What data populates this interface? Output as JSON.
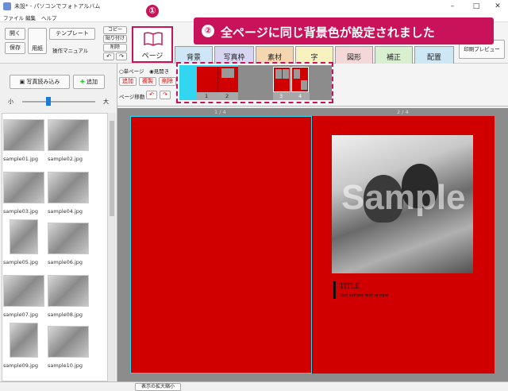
{
  "window": {
    "title": "未設* - パソコンでフォトアルバム",
    "controls": [
      "–",
      "□",
      "✕"
    ]
  },
  "menu": [
    "ファイル",
    "編集",
    "ヘルプ"
  ],
  "toolbar": {
    "open": "開く",
    "save": "保存",
    "paper": "用紙",
    "template": "テンプレート",
    "manual": "操作マニュアル",
    "copy": "コピー",
    "paste": "貼り付け",
    "delete": "削除",
    "print_preview": "印刷プレビュー"
  },
  "tabs": [
    {
      "label": "ページ",
      "color": "#ffffff"
    },
    {
      "label": "背景",
      "color": "#cfe6f7"
    },
    {
      "label": "写真枠",
      "color": "#d6d6f2"
    },
    {
      "label": "素材",
      "color": "#f4d7b0"
    },
    {
      "label": "字",
      "color": "#f7f2c0"
    },
    {
      "label": "図形",
      "color": "#f4d7d7"
    },
    {
      "label": "補正",
      "color": "#d8f0d0"
    },
    {
      "label": "配置",
      "color": "#cde8f4"
    }
  ],
  "page_panel": {
    "single": "単ページ",
    "spread": "見開き",
    "add": "追加",
    "duplicate": "複製",
    "delete": "削除",
    "move": "ページ移動",
    "pages": [
      "1",
      "2",
      "3",
      "4"
    ]
  },
  "callouts": {
    "step1": "①",
    "step2": "②",
    "message": "全ページに同じ背景色が設定されました"
  },
  "left": {
    "load_photos": "写真読み込み",
    "add": "追加",
    "slider_min": "小",
    "slider_max": "大",
    "slider_level": 0.4,
    "photos": [
      "sample01.jpg",
      "sample02.jpg",
      "sample03.jpg",
      "sample04.jpg",
      "sample05.jpg",
      "sample06.jpg",
      "sample07.jpg",
      "sample08.jpg",
      "sample09.jpg",
      "sample10.jpg"
    ]
  },
  "canvas": {
    "page_labels": [
      "1 / 4",
      "2 / 4"
    ],
    "bg_color": "#d10000",
    "text_title": "TITLE",
    "text_sub": "Text sample text sample",
    "watermark": "Sample"
  },
  "status": {
    "zoom_button": "表示の拡大縮小"
  }
}
